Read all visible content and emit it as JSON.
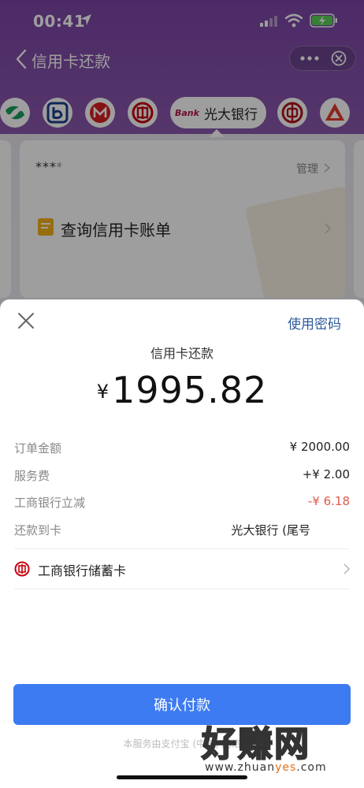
{
  "status": {
    "time": "00:41"
  },
  "nav": {
    "title": "信用卡还款"
  },
  "bank_strip": {
    "selected_bank_tag": "Bank",
    "selected_bank": "光大银行"
  },
  "card": {
    "masked_number": "****",
    "manage": "管理",
    "bill": "查询信用卡账单"
  },
  "sheet": {
    "use_password": "使用密码",
    "title": "信用卡还款",
    "currency": "¥",
    "amount": "1995.82",
    "rows": [
      {
        "label": "订单金额",
        "value": "¥ 2000.00"
      },
      {
        "label": "服务费",
        "value": "+¥ 2.00"
      },
      {
        "label": "工商银行立减",
        "value": "-¥ 6.18"
      },
      {
        "label": "还款到卡",
        "value": "光大银行 (尾号"
      }
    ],
    "pay_method": "工商银行储蓄卡",
    "confirm": "确认付款",
    "footer": "本服务由支付宝 (中国) 网络"
  },
  "watermark": {
    "main": "好赚网",
    "sub_prefix": "www.zhuan",
    "sub_highlight": "yes",
    "sub_suffix": ".com"
  },
  "colors": {
    "brand_purple": "#7c45a6",
    "primary_blue": "#3d7bf2",
    "link_blue": "#2f5a9c",
    "discount_red": "#e05a4a"
  }
}
